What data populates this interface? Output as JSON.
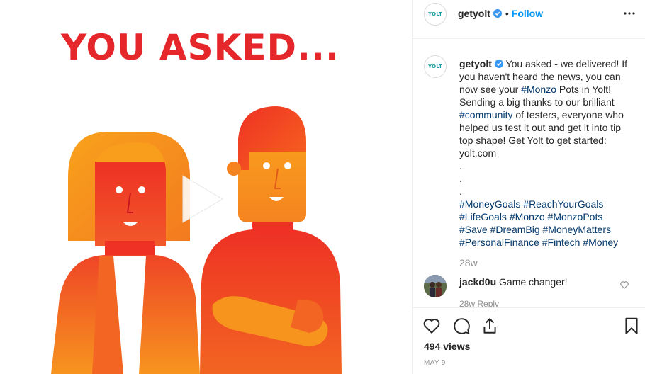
{
  "media": {
    "headline": "YOU ASKED...",
    "play_icon": "play-icon",
    "colors": {
      "headline": "#e5262a",
      "orange": "#f7911e",
      "red": "#ee3124"
    }
  },
  "header": {
    "avatar_text": "YOLT",
    "username": "getyolt",
    "verified_icon": "verified-badge-icon",
    "separator": "•",
    "follow_label": "Follow",
    "more_icon": "more-options-icon"
  },
  "caption": {
    "avatar_text": "YOLT",
    "username": "getyolt",
    "text_1": "You asked - we delivered! If you haven't heard the news, you can now see your ",
    "tag_monzo": "#Monzo",
    "text_2": " Pots in Yolt! Sending a big thanks to our brilliant ",
    "tag_community": "#community",
    "text_3": " of testers, everyone who helped us test it out and get it into tip top shape! Get Yolt to get started: yolt.com",
    "dot_1": ".",
    "dot_2": ".",
    "dot_3": ".",
    "hashtags_line_1": [
      "#MoneyGoals",
      "#ReachYourGoals"
    ],
    "hashtags_line_2": [
      "#LifeGoals",
      "#Monzo",
      "#MonzoPots"
    ],
    "hashtags_line_3": [
      "#Save",
      "#DreamBig",
      "#MoneyMatters"
    ],
    "hashtags_line_4": [
      "#PersonalFinance",
      "#Fintech",
      "#Money"
    ],
    "time_ago": "28w"
  },
  "comment": {
    "username": "jackd0u",
    "text": "Game changer!",
    "meta": "28w  Reply",
    "like_icon": "heart-outline-icon"
  },
  "actions": {
    "like_icon": "heart-icon",
    "comment_icon": "comment-icon",
    "share_icon": "share-icon",
    "save_icon": "bookmark-icon",
    "views": "494 views",
    "date": "MAY 9"
  }
}
